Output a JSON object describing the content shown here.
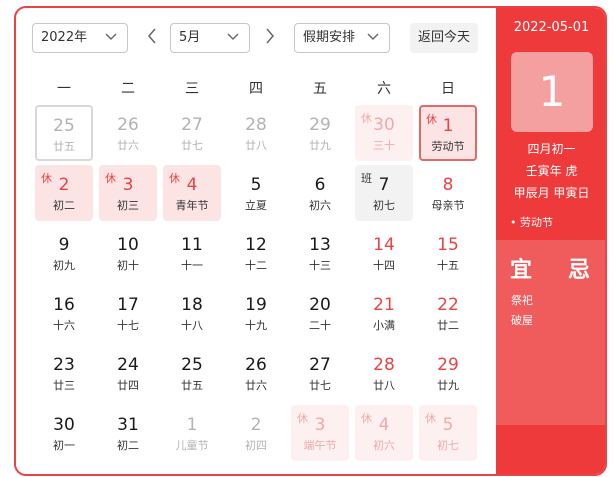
{
  "toolbar": {
    "year_value": "2022年",
    "month_value": "5月",
    "holiday_value": "假期安排",
    "prev_glyph": "‹",
    "next_glyph": "›",
    "today_label": "返回今天",
    "chevron_glyph": "⌄"
  },
  "weekdays": [
    "一",
    "二",
    "三",
    "四",
    "五",
    "六",
    "日"
  ],
  "days": [
    {
      "num": "25",
      "lunar": "廿五",
      "tag": "",
      "kind": "other",
      "outlined": true
    },
    {
      "num": "26",
      "lunar": "廿六",
      "tag": "",
      "kind": "other"
    },
    {
      "num": "27",
      "lunar": "廿七",
      "tag": "",
      "kind": "other"
    },
    {
      "num": "28",
      "lunar": "廿八",
      "tag": "",
      "kind": "other"
    },
    {
      "num": "29",
      "lunar": "廿九",
      "tag": "",
      "kind": "other"
    },
    {
      "num": "30",
      "lunar": "三十",
      "tag": "休",
      "kind": "other-holiday"
    },
    {
      "num": "1",
      "lunar": "劳动节",
      "tag": "休",
      "kind": "holiday",
      "selected": true
    },
    {
      "num": "2",
      "lunar": "初二",
      "tag": "休",
      "kind": "holiday"
    },
    {
      "num": "3",
      "lunar": "初三",
      "tag": "休",
      "kind": "holiday"
    },
    {
      "num": "4",
      "lunar": "青年节",
      "tag": "休",
      "kind": "holiday"
    },
    {
      "num": "5",
      "lunar": "立夏",
      "tag": "",
      "kind": "normal"
    },
    {
      "num": "6",
      "lunar": "初六",
      "tag": "",
      "kind": "normal"
    },
    {
      "num": "7",
      "lunar": "初七",
      "tag": "班",
      "kind": "workday"
    },
    {
      "num": "8",
      "lunar": "母亲节",
      "tag": "",
      "kind": "weekend"
    },
    {
      "num": "9",
      "lunar": "初九",
      "tag": "",
      "kind": "normal"
    },
    {
      "num": "10",
      "lunar": "初十",
      "tag": "",
      "kind": "normal"
    },
    {
      "num": "11",
      "lunar": "十一",
      "tag": "",
      "kind": "normal"
    },
    {
      "num": "12",
      "lunar": "十二",
      "tag": "",
      "kind": "normal"
    },
    {
      "num": "13",
      "lunar": "十三",
      "tag": "",
      "kind": "normal"
    },
    {
      "num": "14",
      "lunar": "十四",
      "tag": "",
      "kind": "weekend"
    },
    {
      "num": "15",
      "lunar": "十五",
      "tag": "",
      "kind": "weekend"
    },
    {
      "num": "16",
      "lunar": "十六",
      "tag": "",
      "kind": "normal"
    },
    {
      "num": "17",
      "lunar": "十七",
      "tag": "",
      "kind": "normal"
    },
    {
      "num": "18",
      "lunar": "十八",
      "tag": "",
      "kind": "normal"
    },
    {
      "num": "19",
      "lunar": "十九",
      "tag": "",
      "kind": "normal"
    },
    {
      "num": "20",
      "lunar": "二十",
      "tag": "",
      "kind": "normal"
    },
    {
      "num": "21",
      "lunar": "小满",
      "tag": "",
      "kind": "weekend"
    },
    {
      "num": "22",
      "lunar": "廿二",
      "tag": "",
      "kind": "weekend"
    },
    {
      "num": "23",
      "lunar": "廿三",
      "tag": "",
      "kind": "normal"
    },
    {
      "num": "24",
      "lunar": "廿四",
      "tag": "",
      "kind": "normal"
    },
    {
      "num": "25",
      "lunar": "廿五",
      "tag": "",
      "kind": "normal"
    },
    {
      "num": "26",
      "lunar": "廿六",
      "tag": "",
      "kind": "normal"
    },
    {
      "num": "27",
      "lunar": "廿七",
      "tag": "",
      "kind": "normal"
    },
    {
      "num": "28",
      "lunar": "廿八",
      "tag": "",
      "kind": "weekend"
    },
    {
      "num": "29",
      "lunar": "廿九",
      "tag": "",
      "kind": "weekend"
    },
    {
      "num": "30",
      "lunar": "初一",
      "tag": "",
      "kind": "normal"
    },
    {
      "num": "31",
      "lunar": "初二",
      "tag": "",
      "kind": "normal"
    },
    {
      "num": "1",
      "lunar": "儿童节",
      "tag": "",
      "kind": "other"
    },
    {
      "num": "2",
      "lunar": "初四",
      "tag": "",
      "kind": "other"
    },
    {
      "num": "3",
      "lunar": "端午节",
      "tag": "休",
      "kind": "other-holiday"
    },
    {
      "num": "4",
      "lunar": "初六",
      "tag": "休",
      "kind": "other-holiday"
    },
    {
      "num": "5",
      "lunar": "初七",
      "tag": "休",
      "kind": "other-holiday"
    }
  ],
  "detail": {
    "date": "2022-05-01",
    "big_day": "1",
    "lunar_date": "四月初一",
    "year_gz": "壬寅年 虎",
    "month_day_gz": "甲辰月 甲寅日",
    "festival": "• 劳动节",
    "yi_label": "宜",
    "ji_label": "忌",
    "yi_items": [
      "祭祀",
      "破屋"
    ]
  },
  "colors": {
    "accent": "#e94343",
    "panel": "#ee3a3a",
    "holiday_bg": "#fde4e4"
  }
}
